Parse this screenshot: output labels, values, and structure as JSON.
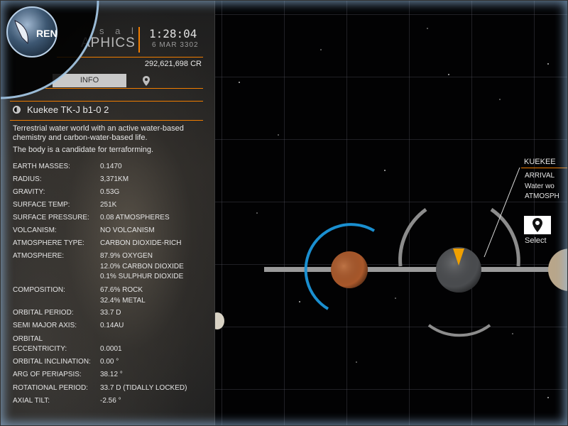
{
  "header": {
    "brand_top": "s a l",
    "brand_main": "APHICS",
    "time": "1:28:04",
    "date": "6 MAR 3302",
    "credits": "292,621,698 CR"
  },
  "commander": {
    "label": "REN"
  },
  "tabs": {
    "info": "INFO",
    "nav_icon": "map-pin-icon"
  },
  "body": {
    "name": "Kuekee TK-J b1-0 2",
    "description_1": "Terrestrial water world with an active water-based chemistry and carbon-water-based life.",
    "description_2": "The body is a candidate for terraforming."
  },
  "stats": [
    {
      "k": "EARTH MASSES:",
      "v": "0.1470"
    },
    {
      "k": "RADIUS:",
      "v": "3,371KM"
    },
    {
      "k": "GRAVITY:",
      "v": "0.53G"
    },
    {
      "k": "SURFACE TEMP:",
      "v": "251K"
    },
    {
      "k": "SURFACE PRESSURE:",
      "v": "0.08 ATMOSPHERES"
    },
    {
      "k": "VOLCANISM:",
      "v": "NO VOLCANISM"
    },
    {
      "k": "ATMOSPHERE TYPE:",
      "v": "CARBON DIOXIDE-RICH"
    },
    {
      "k": "ATMOSPHERE:",
      "v": "87.9% OXYGEN"
    },
    {
      "k": "",
      "v": "12.0% CARBON DIOXIDE"
    },
    {
      "k": "",
      "v": "0.1% SULPHUR DIOXIDE"
    },
    {
      "k": "COMPOSITION:",
      "v": "67.6% ROCK"
    },
    {
      "k": "",
      "v": "32.4% METAL"
    },
    {
      "k": "ORBITAL PERIOD:",
      "v": "33.7 D"
    },
    {
      "k": "SEMI MAJOR AXIS:",
      "v": "0.14AU"
    },
    {
      "k": "ORBITAL",
      "v": ""
    },
    {
      "k": "ECCENTRICITY:",
      "v": "0.0001"
    },
    {
      "k": "ORBITAL INCLINATION:",
      "v": "0.00 °"
    },
    {
      "k": "ARG OF PERIAPSIS:",
      "v": "38.12 °"
    },
    {
      "k": "ROTATIONAL PERIOD:",
      "v": "33.7 D (TIDALLY LOCKED)"
    },
    {
      "k": "AXIAL TILT:",
      "v": "-2.56 °"
    }
  ],
  "map": {
    "target_title": "KUEKEE",
    "target_line_1": "ARRIVAL",
    "target_line_2": "Water wo",
    "target_line_3": "ATMOSPH",
    "select_label": "Select"
  },
  "colors": {
    "accent": "#f07d00",
    "orbit_blue": "#1a8fd0"
  }
}
